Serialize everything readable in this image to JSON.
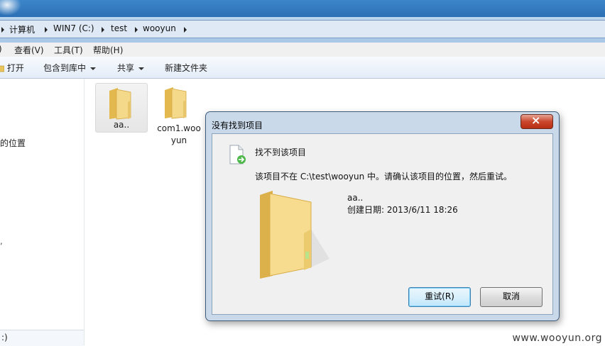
{
  "address": {
    "crumbs": [
      "计算机",
      "WIN7 (C:)",
      "test",
      "wooyun"
    ]
  },
  "menu": [
    "查看(V)",
    "工具(T)",
    "帮助(H)"
  ],
  "commands": {
    "open": "打开",
    "include_library": "包含到库中",
    "share": "共享",
    "new_folder": "新建文件夹"
  },
  "navpane": {
    "partial_text": "的位置",
    "partial_mark": ",",
    "drive_text": ":)"
  },
  "files": [
    {
      "name": "aa..",
      "selected": true
    },
    {
      "name": "com1.woo\nyun",
      "line1": "com1.woo",
      "line2": "yun",
      "selected": false
    }
  ],
  "dialog": {
    "title": "没有找到项目",
    "heading": "找不到该项目",
    "message": "该项目不在 C:\\test\\wooyun 中。请确认该项目的位置，然后重试。",
    "item_name": "aa..",
    "item_created": "创建日期: 2013/6/11 18:26",
    "retry_label": "重试(R)",
    "cancel_label": "取消"
  },
  "watermark": "www.wooyun.org",
  "colors": {
    "accent": "#3d86c9",
    "folder": "#f1d27a",
    "close_button": "#c9462c"
  }
}
